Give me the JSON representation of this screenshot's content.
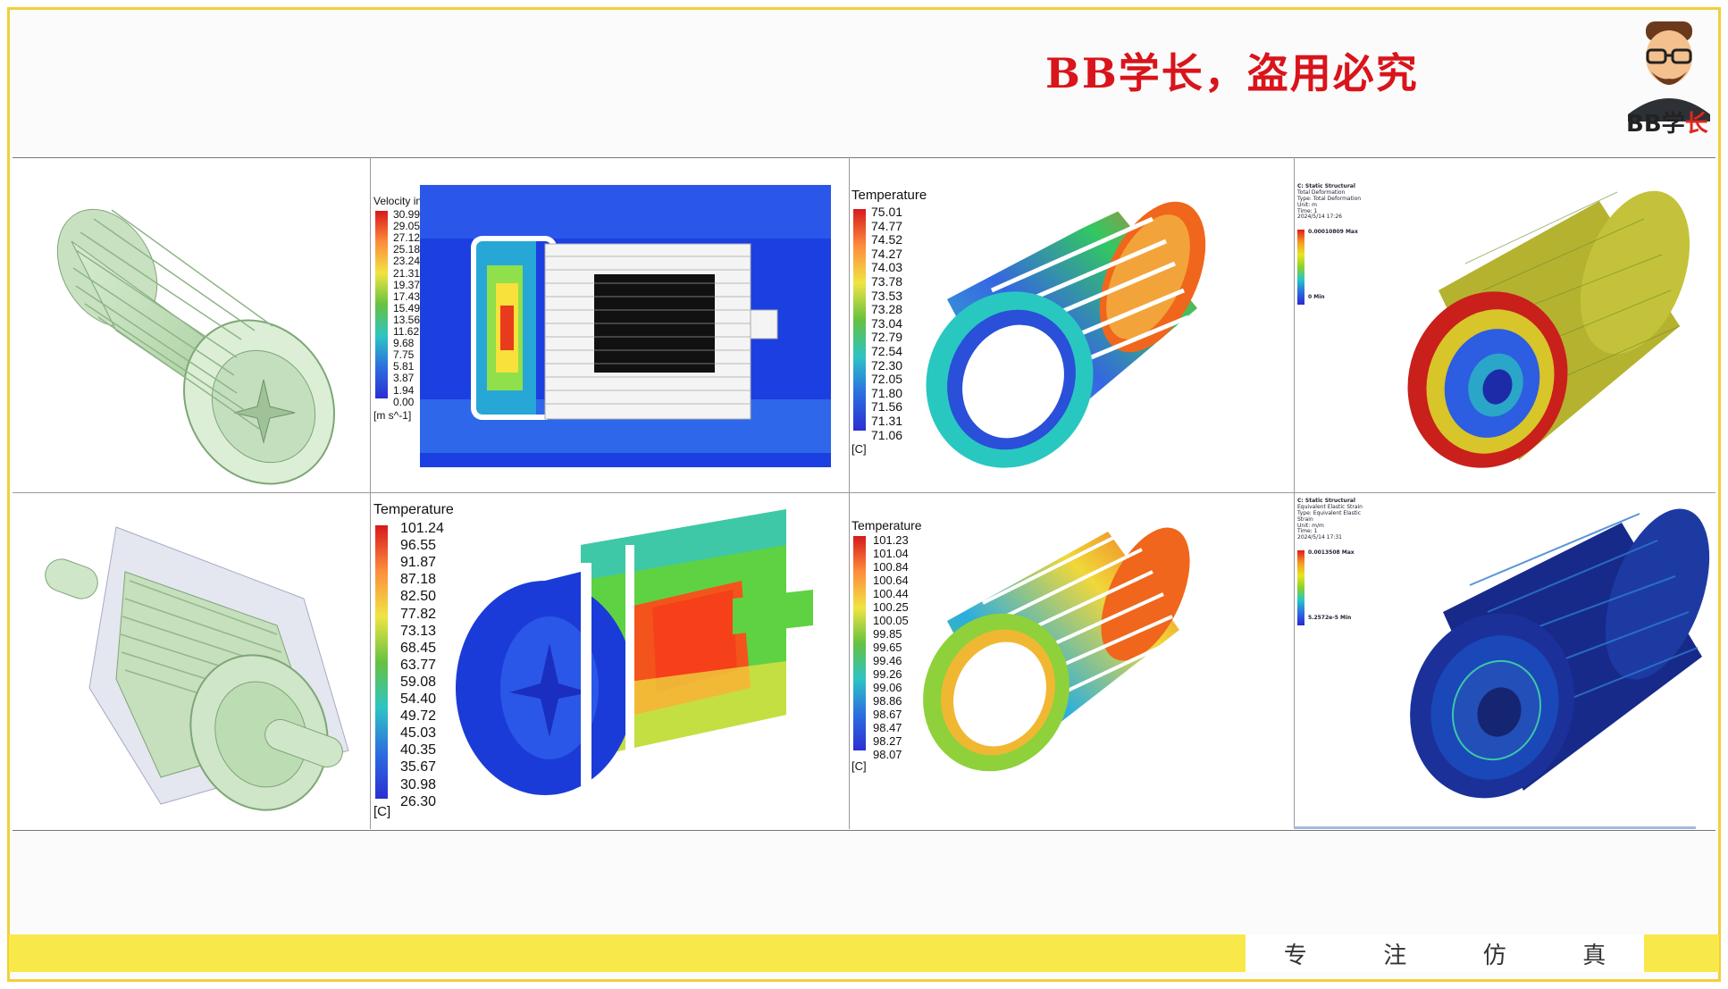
{
  "header": {
    "watermark": "BB学长，盗用必究",
    "logo_prefix": "BB学",
    "logo_accent": "长"
  },
  "panels": {
    "velocity": {
      "title": "Velocity in Stn Frame",
      "unit": "[m s^-1]",
      "values": [
        "30.99",
        "29.05",
        "27.12",
        "25.18",
        "23.24",
        "21.31",
        "19.37",
        "17.43",
        "15.49",
        "13.56",
        "11.62",
        "9.68",
        "7.75",
        "5.81",
        "3.87",
        "1.94",
        "0.00"
      ]
    },
    "temp_top": {
      "title": "Temperature",
      "unit": "[C]",
      "values": [
        "75.01",
        "74.77",
        "74.52",
        "74.27",
        "74.03",
        "73.78",
        "73.53",
        "73.28",
        "73.04",
        "72.79",
        "72.54",
        "72.30",
        "72.05",
        "71.80",
        "71.56",
        "71.31",
        "71.06"
      ]
    },
    "temp_bottom_left": {
      "title": "Temperature",
      "unit": "[C]",
      "values": [
        "101.24",
        "96.55",
        "91.87",
        "87.18",
        "82.50",
        "77.82",
        "73.13",
        "68.45",
        "63.77",
        "59.08",
        "54.40",
        "49.72",
        "45.03",
        "40.35",
        "35.67",
        "30.98",
        "26.30"
      ]
    },
    "temp_bottom_mid": {
      "title": "Temperature",
      "unit": "[C]",
      "values": [
        "101.23",
        "101.04",
        "100.84",
        "100.64",
        "100.44",
        "100.25",
        "100.05",
        "99.85",
        "99.65",
        "99.46",
        "99.26",
        "99.06",
        "98.86",
        "98.67",
        "98.47",
        "98.27",
        "98.07"
      ]
    },
    "struct_top": {
      "lines": [
        "C: Static Structural",
        "Total Deformation",
        "Type: Total Deformation",
        "Unit: m",
        "Time: 1",
        "2024/5/14 17:26"
      ],
      "max": "0.00010809 Max",
      "min": "0 Min"
    },
    "struct_bottom": {
      "lines": [
        "C: Static Structural",
        "Equivalent Elastic Strain",
        "Type: Equivalent Elastic Strain",
        "Unit: m/m",
        "Time: 1",
        "2024/5/14 17:31"
      ],
      "max": "0.0013508 Max",
      "min": "5.2572e-5 Min"
    }
  },
  "footer": {
    "chars": [
      "专",
      "注",
      "仿",
      "真"
    ]
  },
  "colors": {
    "frame": "#f3cf37",
    "footer_bar": "#f9e84a",
    "watermark": "#d9141b"
  }
}
